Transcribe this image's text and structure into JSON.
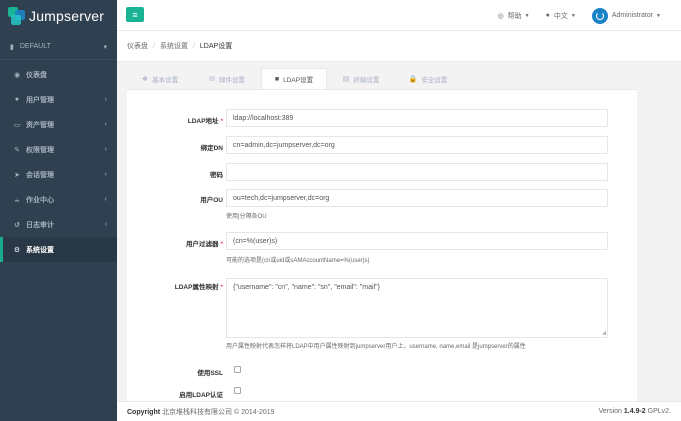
{
  "app": {
    "logo_text": "Jumpserver"
  },
  "sidebar": {
    "org": "DEFAULT",
    "items": [
      {
        "label": "仪表盘",
        "icon": "dashboard-icon",
        "glyph": "◉",
        "arrow": ""
      },
      {
        "label": "用户管理",
        "icon": "users-icon",
        "glyph": "●",
        "arrow": "‹"
      },
      {
        "label": "资产管理",
        "icon": "inbox-icon",
        "glyph": "▭",
        "arrow": "‹"
      },
      {
        "label": "权限管理",
        "icon": "edit-icon",
        "glyph": "✎",
        "arrow": "‹"
      },
      {
        "label": "会话管理",
        "icon": "rocket-icon",
        "glyph": "➤",
        "arrow": "‹"
      },
      {
        "label": "作业中心",
        "icon": "coffee-icon",
        "glyph": "☕",
        "arrow": "‹"
      },
      {
        "label": "日志审计",
        "icon": "history-icon",
        "glyph": "↺",
        "arrow": "‹"
      },
      {
        "label": "系统设置",
        "icon": "gears-icon",
        "glyph": "⚙",
        "arrow": ""
      }
    ]
  },
  "topbar": {
    "help": "帮助",
    "language": "中文",
    "user": "Administrator"
  },
  "breadcrumb": [
    "仪表盘",
    "系统设置",
    "LDAP设置"
  ],
  "tabs": [
    {
      "label": "基本设置",
      "icon": "cubes-icon",
      "glyph": "❖"
    },
    {
      "label": "邮件设置",
      "icon": "envelope-icon",
      "glyph": "✉"
    },
    {
      "label": "LDAP设置",
      "icon": "database-icon",
      "glyph": "■"
    },
    {
      "label": "终端设置",
      "icon": "hdd-icon",
      "glyph": "▤"
    },
    {
      "label": "安全设置",
      "icon": "lock-icon",
      "glyph": "🔒"
    }
  ],
  "form": {
    "ldap_url": {
      "label": "LDAP地址",
      "value": "ldap://localhost:389"
    },
    "bind_dn": {
      "label": "绑定DN",
      "value": "cn=admin,dc=jumpserver,dc=org"
    },
    "password": {
      "label": "密码",
      "value": ""
    },
    "user_ou": {
      "label": "用户OU",
      "value": "ou=tech,dc=jumpserver,dc=org",
      "help": "使用|分隔各OU"
    },
    "user_filter": {
      "label": "用户过滤器",
      "value": "(cn=%(user)s)",
      "help": "可能的选项是(cn或uid或sAMAccountName=%(user)s)"
    },
    "attr_map": {
      "label": "LDAP属性映射",
      "value": "{\"username\": \"cn\", \"name\": \"sn\", \"email\": \"mail\"}",
      "help": "用户属性映射代表怎样将LDAP中用户属性映射到jumpserver用户上，username, name,email 是jumpserver的属性"
    },
    "use_ssl": {
      "label": "使用SSL",
      "checked": false
    },
    "enable_ldap": {
      "label": "启用LDAP认证",
      "checked": false
    }
  },
  "footer": {
    "copyright_label": "Copyright",
    "copyright_text": "北京堆栈科技有限公司 © 2014-2019",
    "version_label": "Version",
    "version_num": "1.4.9-2",
    "license": "GPLv2."
  },
  "colors": {
    "sidebar_bg": "#2f4050",
    "accent": "#1ab394",
    "required": "#ed5565"
  }
}
